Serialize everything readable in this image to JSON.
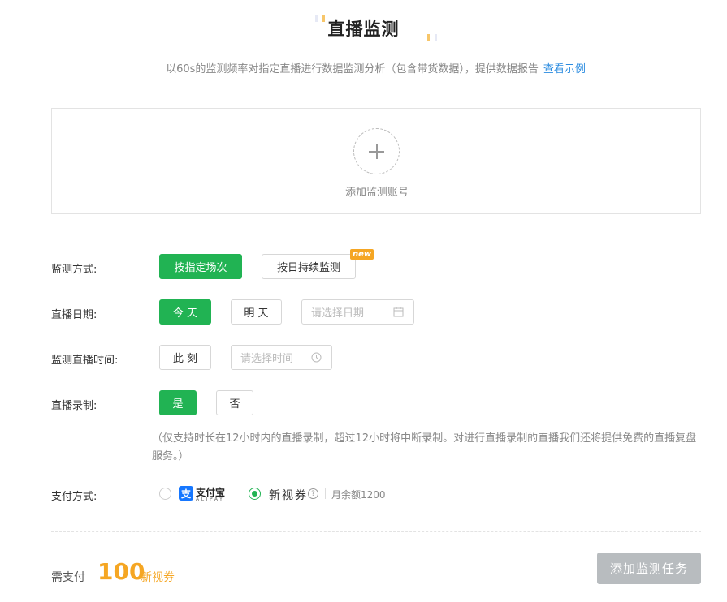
{
  "header": {
    "title": "直播监测",
    "subtitle": "以60s的监测频率对指定直播进行数据监测分析（包含带货数据），提供数据报告",
    "example_link": "查看示例"
  },
  "add_account": {
    "label": "添加监测账号"
  },
  "monitor_mode": {
    "label": "监测方式:",
    "options": [
      "按指定场次",
      "按日持续监测"
    ],
    "selected": "按指定场次",
    "new_badge": "new"
  },
  "live_date": {
    "label": "直播日期:",
    "today": "今 天",
    "tomorrow": "明 天",
    "placeholder": "请选择日期"
  },
  "live_time": {
    "label": "监测直播时间:",
    "now": "此 刻",
    "placeholder": "请选择时间"
  },
  "recording": {
    "label": "直播录制:",
    "yes": "是",
    "no": "否",
    "selected": "是",
    "note": "（仅支持时长在12小时内的直播录制，超过12小时将中断录制。对进行直播录制的直播我们还将提供免费的直播复盘服务。）"
  },
  "payment": {
    "label": "支付方式:",
    "alipay_name": "支付宝",
    "alipay_sub": "ALIPAY",
    "coupon_name": "新视券",
    "help": "?",
    "balance": "月余额1200",
    "selected": "新视券"
  },
  "footer": {
    "pay_label": "需支付",
    "amount": "100",
    "unit": "新视券",
    "submit_label": "添加监测任务"
  },
  "colors": {
    "primary_green": "#21b353",
    "accent_orange": "#f5a623",
    "link_blue": "#2b8ce0",
    "disabled_gray": "#b8bcbf"
  },
  "icons": {
    "date_picker": "calendar-icon",
    "time_picker": "clock-icon",
    "add": "plus-icon",
    "help": "question-circle-icon"
  }
}
